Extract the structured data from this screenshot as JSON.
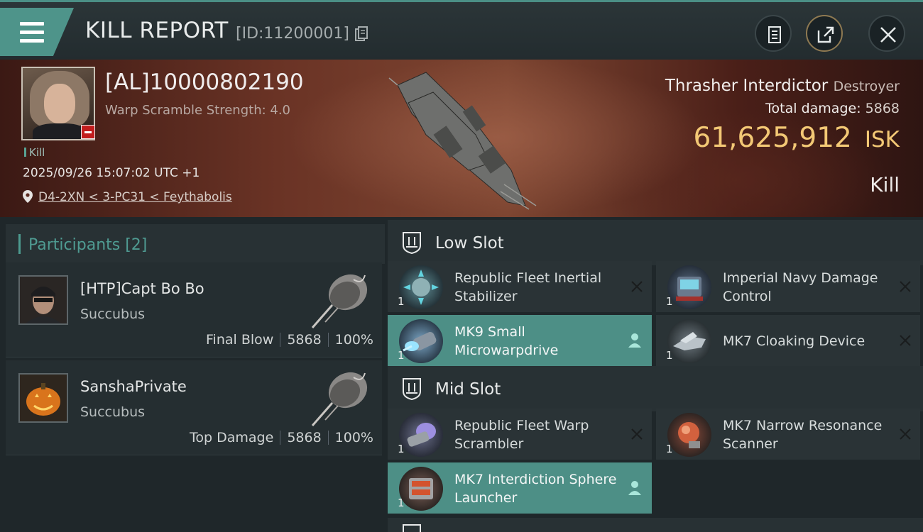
{
  "header": {
    "title": "KILL REPORT",
    "report_id": "[ID:11200001]"
  },
  "victim": {
    "name": "[AL]10000802190",
    "subtitle": "Warp Scramble Strength: 4.0",
    "tag": "Kill",
    "timestamp": "2025/09/26 15:07:02 UTC +1",
    "location": "D4-2XN < 3-PC31 < Feythabolis"
  },
  "ship": {
    "name": "Thrasher Interdictor",
    "class": "Destroyer",
    "total_damage_label": "Total damage:",
    "total_damage_value": "5868",
    "isk_value": "61,625,912",
    "isk_unit": "ISK",
    "result": "Kill"
  },
  "participants": {
    "header": "Participants [2]",
    "items": [
      {
        "name": "[HTP]Capt Bo Bo",
        "ship": "Succubus",
        "role": "Final Blow",
        "damage": "5868",
        "percent": "100%"
      },
      {
        "name": "SanshaPrivate",
        "ship": "Succubus",
        "role": "Top Damage",
        "damage": "5868",
        "percent": "100%"
      }
    ]
  },
  "slots": {
    "low": {
      "label": "Low Slot",
      "modules": [
        {
          "name": "Republic Fleet Inertial Stabilizer",
          "qty": "1",
          "status": "destroyed"
        },
        {
          "name": "Imperial Navy Damage Control",
          "qty": "1",
          "status": "destroyed"
        },
        {
          "name": "MK9 Small Microwarpdrive",
          "qty": "1",
          "status": "dropped"
        },
        {
          "name": "MK7 Cloaking Device",
          "qty": "1",
          "status": "destroyed"
        }
      ]
    },
    "mid": {
      "label": "Mid Slot",
      "modules": [
        {
          "name": "Republic Fleet Warp Scrambler",
          "qty": "1",
          "status": "destroyed"
        },
        {
          "name": "MK7 Narrow Resonance Scanner",
          "qty": "1",
          "status": "destroyed"
        },
        {
          "name": "MK7 Interdiction Sphere Launcher",
          "qty": "1",
          "status": "dropped"
        }
      ]
    }
  },
  "colors": {
    "accent": "#4e948a",
    "isk": "#f3c875",
    "corp_badge": "#c21d1d"
  }
}
